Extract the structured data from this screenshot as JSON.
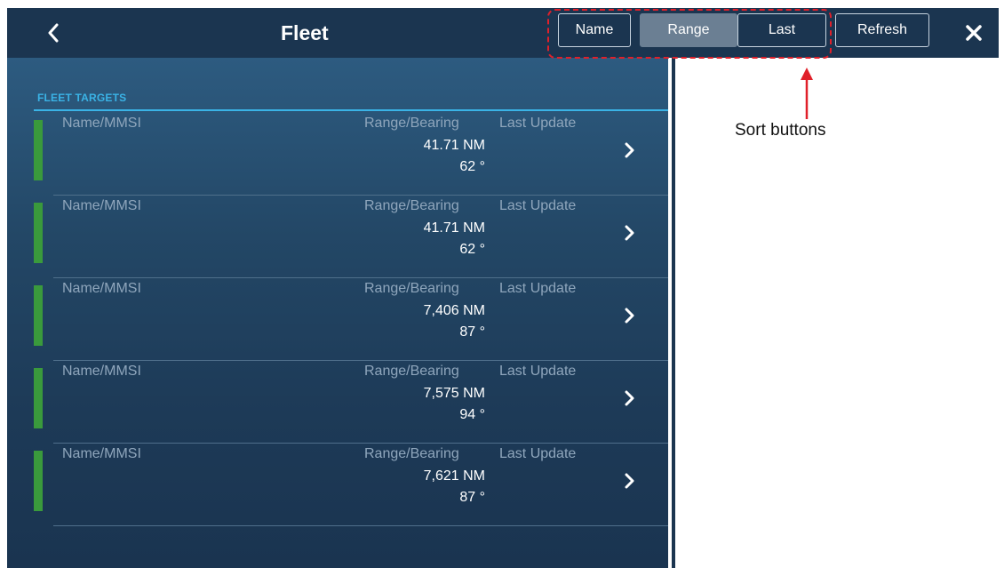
{
  "header": {
    "title": "Fleet",
    "back_icon": "chevron-left-icon",
    "close_icon": "close-icon"
  },
  "sort_buttons": {
    "name_label": "Name",
    "range_label": "Range",
    "last_label": "Last",
    "active": "Range"
  },
  "refresh_label": "Refresh",
  "section_title": "FLEET TARGETS",
  "column_labels": {
    "name": "Name/MMSI",
    "range_bearing": "Range/Bearing",
    "last_update": "Last Update"
  },
  "targets": [
    {
      "range": "41.71 NM",
      "bearing": "62 °"
    },
    {
      "range": "41.71 NM",
      "bearing": "62 °"
    },
    {
      "range": "7,406 NM",
      "bearing": "87 °"
    },
    {
      "range": "7,575 NM",
      "bearing": "94 °"
    },
    {
      "range": "7,621 NM",
      "bearing": "87 °"
    }
  ],
  "callout": {
    "label": "Sort buttons"
  },
  "colors": {
    "header_bg": "#1b3550",
    "accent_blue": "#3ab3e6",
    "status_green": "#3a9a3c",
    "active_button": "#6b7f93",
    "callout_red": "#e0202a"
  }
}
